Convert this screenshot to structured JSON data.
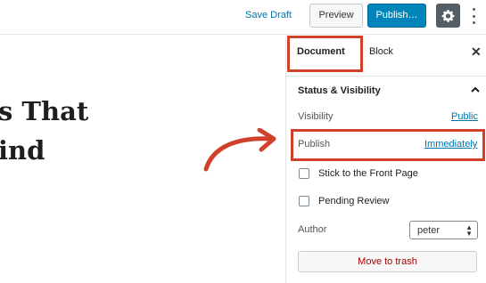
{
  "header": {
    "save_draft": "Save Draft",
    "preview": "Preview",
    "publish": "Publish…",
    "settings_icon": "gear-icon",
    "more_icon": "vertical-ellipsis-icon",
    "publish_color": "#0085ba"
  },
  "editor": {
    "title_line1": "s That",
    "title_line2": "ind"
  },
  "sidebar": {
    "tabs": [
      {
        "label": "Document"
      },
      {
        "label": "Block"
      }
    ],
    "close": "✕",
    "panel_title": "Status & Visibility",
    "visibility": {
      "label": "Visibility",
      "value": "Public"
    },
    "publish": {
      "label": "Publish",
      "value": "Immediately"
    },
    "stick_front": "Stick to the Front Page",
    "pending_review": "Pending Review",
    "author": {
      "label": "Author",
      "value": "peter"
    },
    "trash": "Move to trash"
  },
  "annotation_color": "#d0412b"
}
